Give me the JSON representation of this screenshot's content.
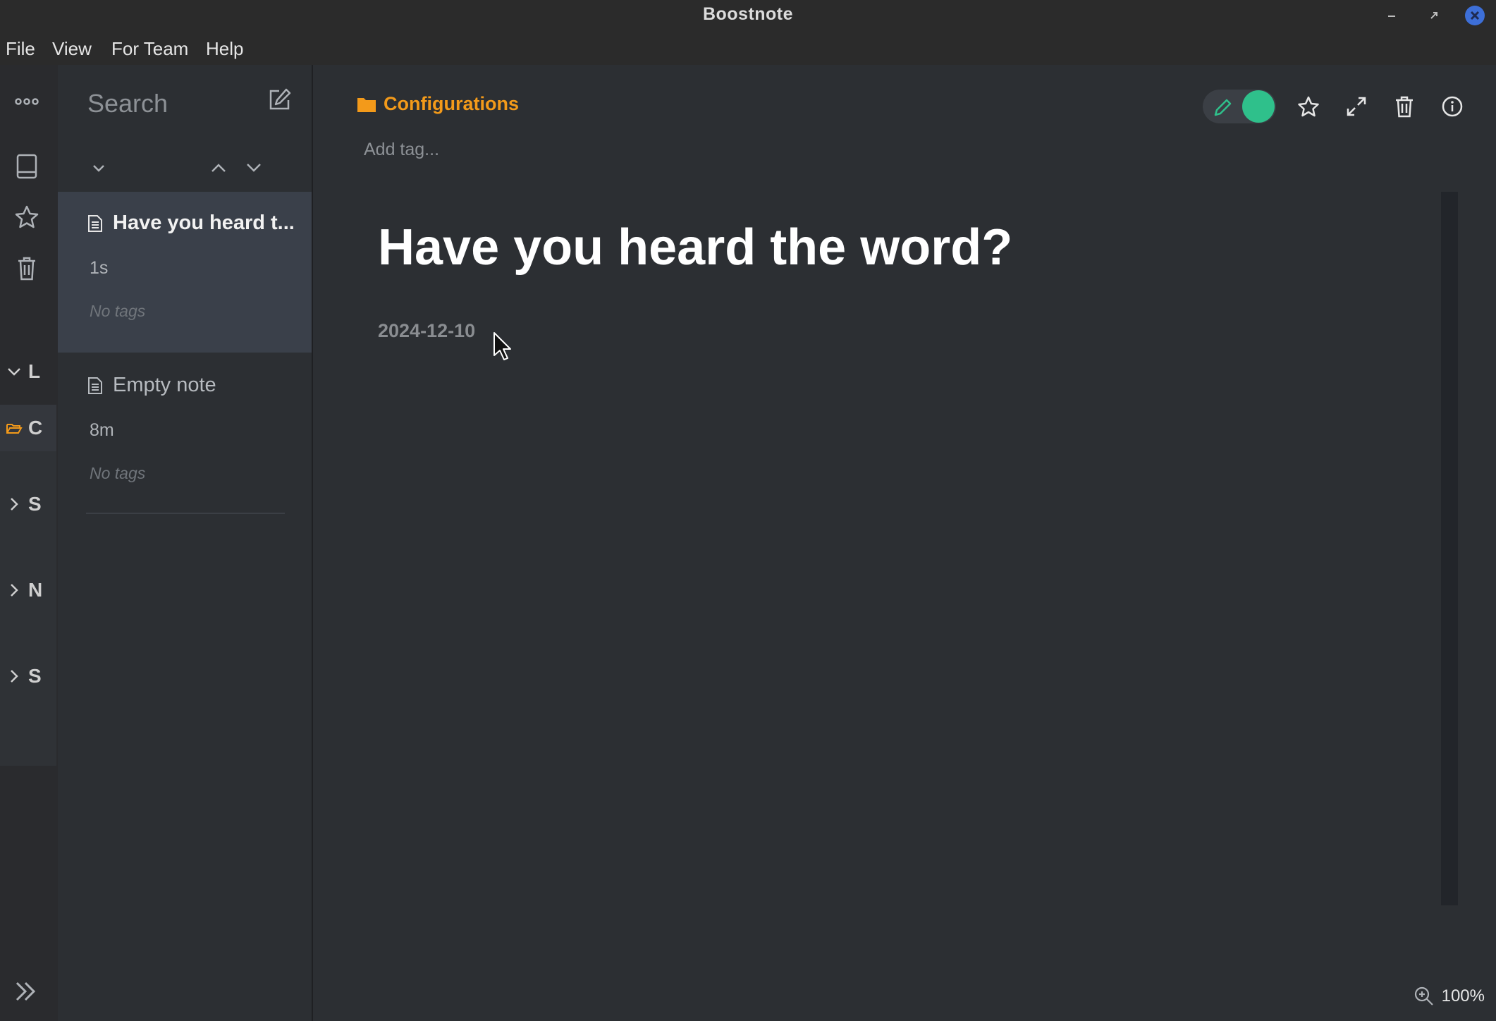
{
  "app": {
    "window_title": "Boostnote"
  },
  "menu": [
    "File",
    "View",
    "For Team",
    "Help"
  ],
  "rail": {
    "icons": [
      "more-icon",
      "notebook-icon",
      "star-icon",
      "trash-icon"
    ],
    "folders": [
      {
        "letter": "L",
        "state": "expanded"
      },
      {
        "letter": "C",
        "state": "active"
      },
      {
        "letter": "S",
        "state": "collapsed"
      },
      {
        "letter": "N",
        "state": "collapsed"
      },
      {
        "letter": "S",
        "state": "collapsed"
      }
    ]
  },
  "notelist": {
    "search_placeholder": "Search",
    "notes": [
      {
        "title": "Have you heard t...",
        "time": "1s",
        "tags": "No tags",
        "selected": true
      },
      {
        "title": "Empty note",
        "time": "8m",
        "tags": "No tags",
        "selected": false
      }
    ]
  },
  "editor": {
    "folder": "Configurations",
    "add_tag_placeholder": "Add tag...",
    "title": "Have you heard the word?",
    "date": "2024-12-10",
    "zoom": "100%"
  },
  "colors": {
    "accent_folder": "#f39a1a",
    "toggle_on": "#2fc08b",
    "close_button": "#3d6fd8"
  }
}
